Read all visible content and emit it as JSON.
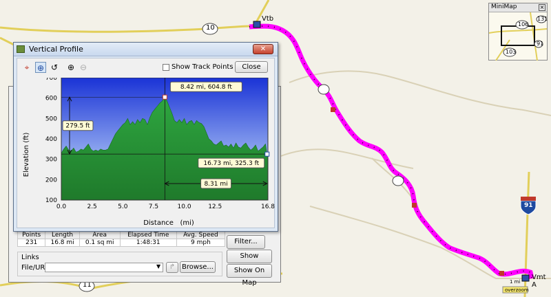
{
  "map": {
    "road_labels": [
      "10",
      "11"
    ],
    "interstate": "91",
    "waypoints": [
      "Vtb",
      "Vmt A"
    ],
    "overzoom": "overzoom",
    "scale": "1 mi",
    "colors": {
      "track": "#ff00ff",
      "road_major": "#e2cf5a",
      "road_minor": "#d9d1b6",
      "bg": "#f3f1e8"
    }
  },
  "minimap": {
    "title": "MiniMap",
    "labels": [
      "106",
      "103",
      "91",
      "131"
    ]
  },
  "vertical_profile": {
    "title": "Vertical Profile",
    "show_track_points_label": "Show Track Points",
    "close_label": "Close",
    "tools": [
      "crosshair-icon",
      "select-icon",
      "lasso-icon",
      "zoom-in-icon",
      "zoom-out-icon"
    ]
  },
  "track_stats": {
    "headers": [
      "Points",
      "Length",
      "Area",
      "Elapsed Time",
      "Avg. Speed"
    ],
    "values": [
      "231",
      "16.8 mi",
      "0.1 sq mi",
      "1:48:31",
      "9 mph"
    ]
  },
  "props_buttons": {
    "filter": "Filter...",
    "show_profile": "Show Profile...",
    "show_on_map": "Show On Map",
    "browse": "Browse..."
  },
  "links": {
    "title": "Links",
    "file_url_label": "File/URL:",
    "file_url_value": ""
  },
  "chart_data": {
    "type": "area",
    "xlabel": "Distance   (mi)",
    "ylabel": "Elevation (ft)",
    "xlim": [
      0,
      16.8
    ],
    "ylim": [
      100,
      700
    ],
    "xticks": [
      "0.0",
      "2.5",
      "5.0",
      "7.5",
      "10.0",
      "12.5",
      "16.8"
    ],
    "yticks": [
      "100",
      "200",
      "300",
      "400",
      "500",
      "600",
      "700"
    ],
    "grid": false,
    "x": [
      0,
      0.2,
      0.4,
      0.6,
      0.8,
      1.0,
      1.2,
      1.4,
      1.6,
      1.8,
      2.0,
      2.2,
      2.4,
      2.6,
      2.8,
      3.0,
      3.2,
      3.4,
      3.6,
      3.8,
      4.0,
      4.2,
      4.4,
      4.6,
      4.8,
      5.0,
      5.2,
      5.4,
      5.6,
      5.8,
      6.0,
      6.2,
      6.4,
      6.6,
      6.8,
      7.0,
      7.2,
      7.4,
      7.6,
      7.8,
      8.0,
      8.2,
      8.42,
      8.6,
      8.8,
      9.0,
      9.2,
      9.4,
      9.6,
      9.8,
      10.0,
      10.2,
      10.4,
      10.6,
      10.8,
      11.0,
      11.2,
      11.4,
      11.6,
      11.8,
      12.0,
      12.2,
      12.4,
      12.6,
      12.8,
      13.0,
      13.2,
      13.4,
      13.6,
      13.8,
      14.0,
      14.2,
      14.4,
      14.6,
      14.8,
      15.0,
      15.2,
      15.4,
      15.6,
      15.8,
      16.0,
      16.2,
      16.4,
      16.6,
      16.73,
      16.8
    ],
    "y": [
      330,
      350,
      365,
      345,
      340,
      355,
      335,
      340,
      350,
      345,
      360,
      375,
      350,
      340,
      345,
      340,
      350,
      345,
      345,
      350,
      375,
      400,
      425,
      440,
      455,
      470,
      480,
      500,
      470,
      485,
      470,
      495,
      480,
      500,
      495,
      470,
      505,
      530,
      545,
      560,
      575,
      585,
      604.8,
      585,
      555,
      525,
      490,
      480,
      495,
      480,
      500,
      470,
      485,
      490,
      470,
      490,
      480,
      475,
      460,
      430,
      400,
      390,
      375,
      370,
      380,
      390,
      365,
      370,
      360,
      375,
      355,
      380,
      360,
      355,
      370,
      380,
      360,
      345,
      355,
      370,
      340,
      350,
      360,
      375,
      325.3,
      330
    ],
    "annotations": [
      {
        "text": "8.42 mi, 604.8 ft",
        "x": 8.42,
        "y": 604.8
      },
      {
        "text": "16.73 mi, 325.3 ft",
        "x": 16.73,
        "y": 325.3
      },
      {
        "text": "279.5 ft",
        "kind": "elevation-difference"
      },
      {
        "text": "8.31 mi",
        "kind": "distance-difference"
      }
    ]
  }
}
